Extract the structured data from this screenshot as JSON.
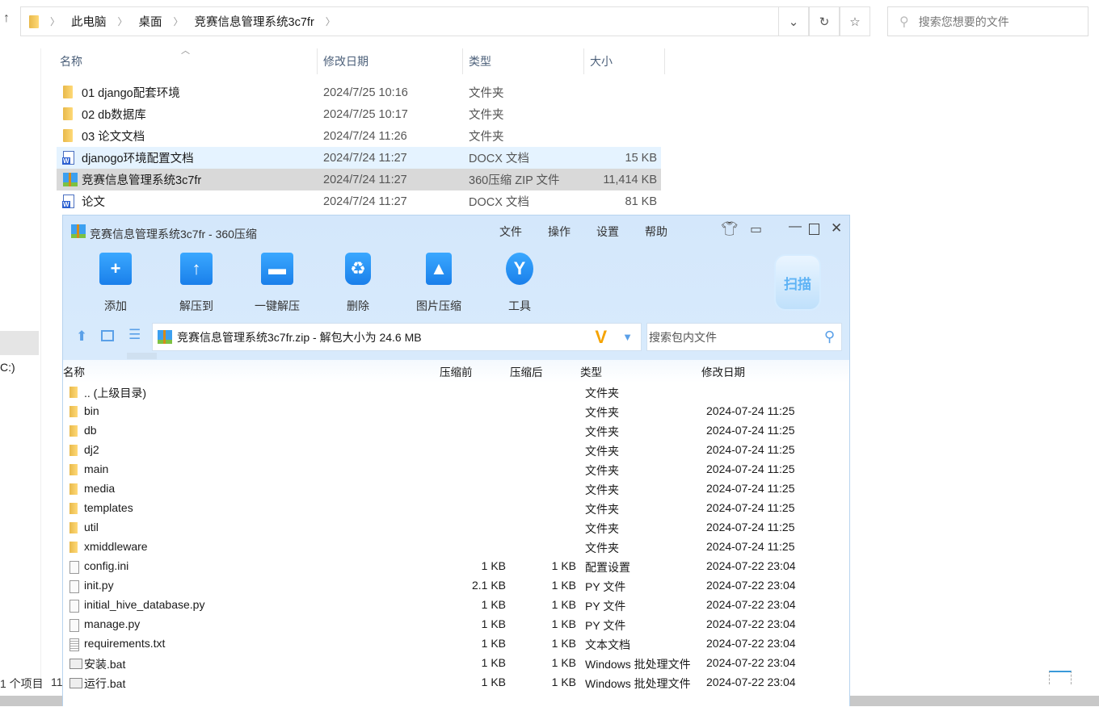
{
  "explorer": {
    "breadcrumb": [
      "此电脑",
      "桌面",
      "竞赛信息管理系统3c7fr"
    ],
    "search_placeholder": "搜索您想要的文件",
    "columns": {
      "name": "名称",
      "date": "修改日期",
      "type": "类型",
      "size": "大小"
    },
    "rows": [
      {
        "name": "01 django配套环境",
        "date": "2024/7/25 10:16",
        "type": "文件夹",
        "size": "",
        "icon": "folder"
      },
      {
        "name": "02 db数据库",
        "date": "2024/7/25 10:17",
        "type": "文件夹",
        "size": "",
        "icon": "folder"
      },
      {
        "name": "03 论文文档",
        "date": "2024/7/24 11:26",
        "type": "文件夹",
        "size": "",
        "icon": "folder"
      },
      {
        "name": "djanogo环境配置文档",
        "date": "2024/7/24 11:27",
        "type": "DOCX 文档",
        "size": "15 KB",
        "icon": "word"
      },
      {
        "name": "竞赛信息管理系统3c7fr",
        "date": "2024/7/24 11:27",
        "type": "360压缩 ZIP 文件",
        "size": "11,414 KB",
        "icon": "zip"
      },
      {
        "name": "论文",
        "date": "2024/7/24 11:27",
        "type": "DOCX 文档",
        "size": "81 KB",
        "icon": "word"
      }
    ],
    "nav_drive": "C:)",
    "status": "1 个项目",
    "status2": "11"
  },
  "zipwin": {
    "title": "竞赛信息管理系统3c7fr - 360压缩",
    "menu": [
      "文件",
      "操作",
      "设置",
      "帮助"
    ],
    "tools": [
      "添加",
      "解压到",
      "一键解压",
      "删除",
      "图片压缩",
      "工具"
    ],
    "scan": "扫描",
    "path": "竞赛信息管理系统3c7fr.zip - 解包大小为 24.6 MB",
    "search_placeholder": "搜索包内文件",
    "columns": {
      "name": "名称",
      "before": "压缩前",
      "after": "压缩后",
      "type": "类型",
      "date": "修改日期"
    },
    "rows": [
      {
        "name": ".. (上级目录)",
        "before": "",
        "after": "",
        "type": "文件夹",
        "date": "",
        "icon": "folder"
      },
      {
        "name": "bin",
        "before": "",
        "after": "",
        "type": "文件夹",
        "date": "2024-07-24 11:25",
        "icon": "folder"
      },
      {
        "name": "db",
        "before": "",
        "after": "",
        "type": "文件夹",
        "date": "2024-07-24 11:25",
        "icon": "folder"
      },
      {
        "name": "dj2",
        "before": "",
        "after": "",
        "type": "文件夹",
        "date": "2024-07-24 11:25",
        "icon": "folder"
      },
      {
        "name": "main",
        "before": "",
        "after": "",
        "type": "文件夹",
        "date": "2024-07-24 11:25",
        "icon": "folder"
      },
      {
        "name": "media",
        "before": "",
        "after": "",
        "type": "文件夹",
        "date": "2024-07-24 11:25",
        "icon": "folder"
      },
      {
        "name": "templates",
        "before": "",
        "after": "",
        "type": "文件夹",
        "date": "2024-07-24 11:25",
        "icon": "folder"
      },
      {
        "name": "util",
        "before": "",
        "after": "",
        "type": "文件夹",
        "date": "2024-07-24 11:25",
        "icon": "folder"
      },
      {
        "name": "xmiddleware",
        "before": "",
        "after": "",
        "type": "文件夹",
        "date": "2024-07-24 11:25",
        "icon": "folder"
      },
      {
        "name": "config.ini",
        "before": "1 KB",
        "after": "1 KB",
        "type": "配置设置",
        "date": "2024-07-22 23:04",
        "icon": "file"
      },
      {
        "name": "init.py",
        "before": "2.1 KB",
        "after": "1 KB",
        "type": "PY 文件",
        "date": "2024-07-22 23:04",
        "icon": "file"
      },
      {
        "name": "initial_hive_database.py",
        "before": "1 KB",
        "after": "1 KB",
        "type": "PY 文件",
        "date": "2024-07-22 23:04",
        "icon": "file"
      },
      {
        "name": "manage.py",
        "before": "1 KB",
        "after": "1 KB",
        "type": "PY 文件",
        "date": "2024-07-22 23:04",
        "icon": "file"
      },
      {
        "name": "requirements.txt",
        "before": "1 KB",
        "after": "1 KB",
        "type": "文本文档",
        "date": "2024-07-22 23:04",
        "icon": "txt"
      },
      {
        "name": "安装.bat",
        "before": "1 KB",
        "after": "1 KB",
        "type": "Windows 批处理文件",
        "date": "2024-07-22 23:04",
        "icon": "bat"
      },
      {
        "name": "运行.bat",
        "before": "1 KB",
        "after": "1 KB",
        "type": "Windows 批处理文件",
        "date": "2024-07-22 23:04",
        "icon": "bat"
      }
    ]
  }
}
